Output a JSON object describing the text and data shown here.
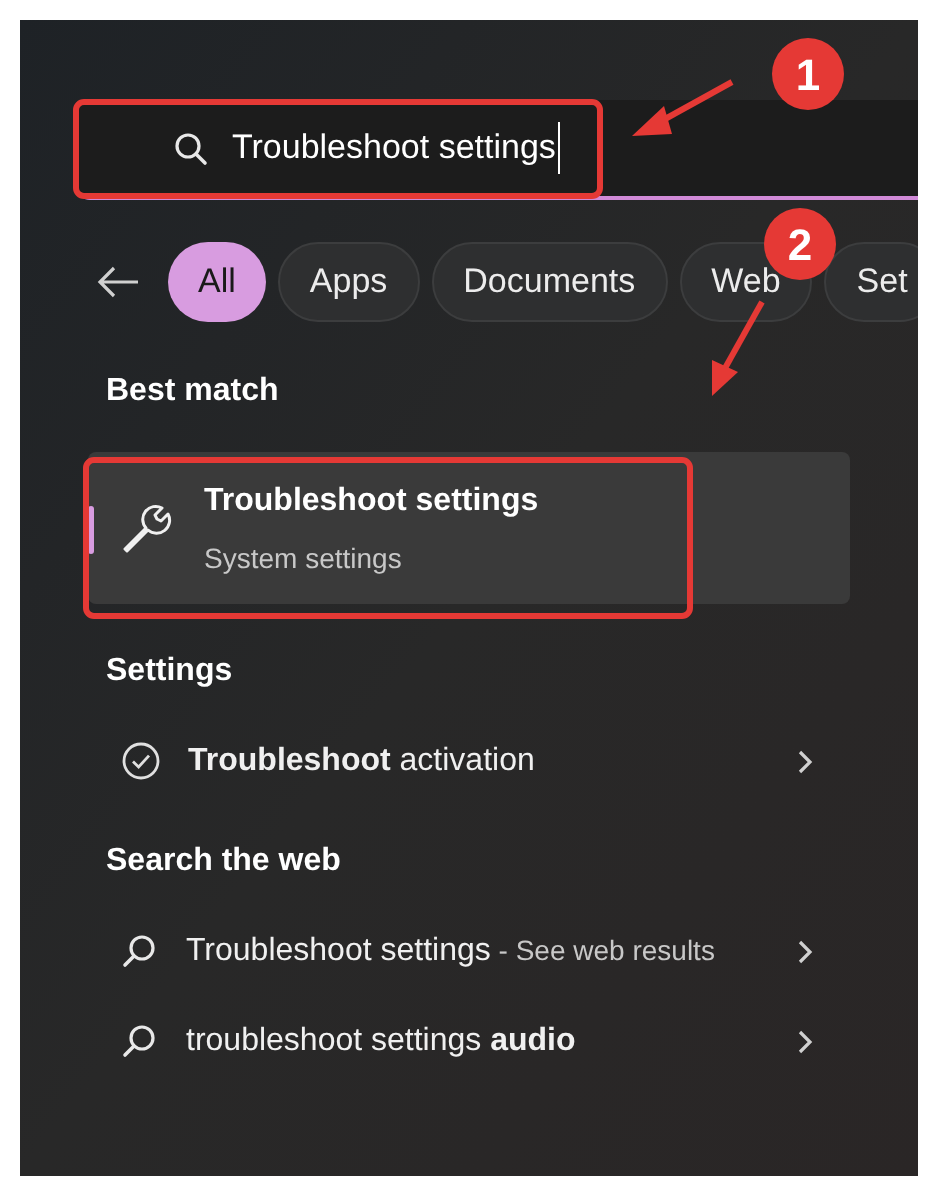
{
  "search": {
    "value": "Troubleshoot settings"
  },
  "filters": [
    {
      "label": "All",
      "selected": true
    },
    {
      "label": "Apps",
      "selected": false
    },
    {
      "label": "Documents",
      "selected": false
    },
    {
      "label": "Web",
      "selected": false
    },
    {
      "label": "Set",
      "selected": false
    }
  ],
  "best_match": {
    "heading": "Best match",
    "title": "Troubleshoot settings",
    "subtitle": "System settings",
    "selected": true
  },
  "sections": [
    {
      "heading": "Settings",
      "items": [
        {
          "kind": "setting",
          "text": "**Troubleshoot** activation"
        }
      ]
    },
    {
      "heading": "Search the web",
      "items": [
        {
          "kind": "web",
          "text": "Troubleshoot settings",
          "suffix": "- See web results"
        },
        {
          "kind": "web",
          "text": "troubleshoot settings **audio**"
        }
      ]
    }
  ],
  "annotations": [
    {
      "number": "1"
    },
    {
      "number": "2"
    }
  ]
}
